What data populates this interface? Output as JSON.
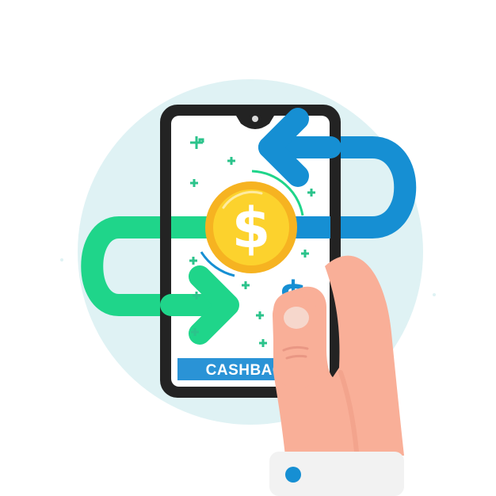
{
  "screen": {
    "button_label": "CASHBACK",
    "coin_symbol": "$",
    "small_symbol": "$"
  },
  "icons": [
    "background-circle-icon",
    "smartphone-icon",
    "camera-notch-icon",
    "gold-coin-icon",
    "blue-arrow-icon",
    "green-arrow-icon",
    "hand-icon",
    "sparkle-icon"
  ],
  "colors": {
    "background_circle": "#dff2f4",
    "phone_frame": "#232323",
    "phone_screen": "#ffffff",
    "coin_outer": "#f6b321",
    "coin_inner": "#fcd22d",
    "blue_arrow": "#168fd3",
    "green_arrow": "#1fd58a",
    "button": "#2a93d6",
    "hand_skin": "#f9af98",
    "sleeve": "#f2f2f2",
    "sparkle": "#2bc38b"
  }
}
